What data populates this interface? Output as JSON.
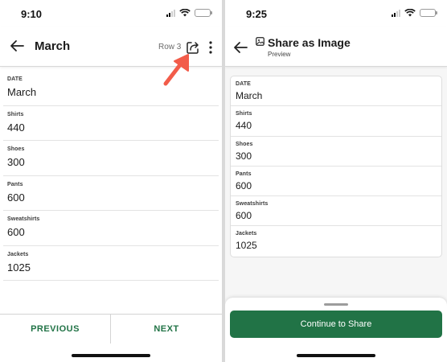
{
  "colors": {
    "accent": "#217346",
    "annotation_arrow": "#f25c4a"
  },
  "left_screen": {
    "status_time": "9:10",
    "header": {
      "title": "March",
      "row_label": "Row 3",
      "back_icon": "arrow-left-icon",
      "share_icon": "share-icon",
      "more_icon": "more-vertical-icon"
    },
    "fields": [
      {
        "label": "DATE",
        "value": "March"
      },
      {
        "label": "Shirts",
        "value": "440"
      },
      {
        "label": "Shoes",
        "value": "300"
      },
      {
        "label": "Pants",
        "value": "600"
      },
      {
        "label": "Sweatshirts",
        "value": "600"
      },
      {
        "label": "Jackets",
        "value": "1025"
      }
    ],
    "nav": {
      "previous": "PREVIOUS",
      "next": "NEXT"
    }
  },
  "right_screen": {
    "status_time": "9:25",
    "header": {
      "title": "Share as Image",
      "subtitle": "Preview",
      "back_icon": "arrow-left-icon",
      "title_icon": "image-icon"
    },
    "fields": [
      {
        "label": "DATE",
        "value": "March"
      },
      {
        "label": "Shirts",
        "value": "440"
      },
      {
        "label": "Shoes",
        "value": "300"
      },
      {
        "label": "Pants",
        "value": "600"
      },
      {
        "label": "Sweatshirts",
        "value": "600"
      },
      {
        "label": "Jackets",
        "value": "1025"
      }
    ],
    "continue_label": "Continue to Share"
  }
}
